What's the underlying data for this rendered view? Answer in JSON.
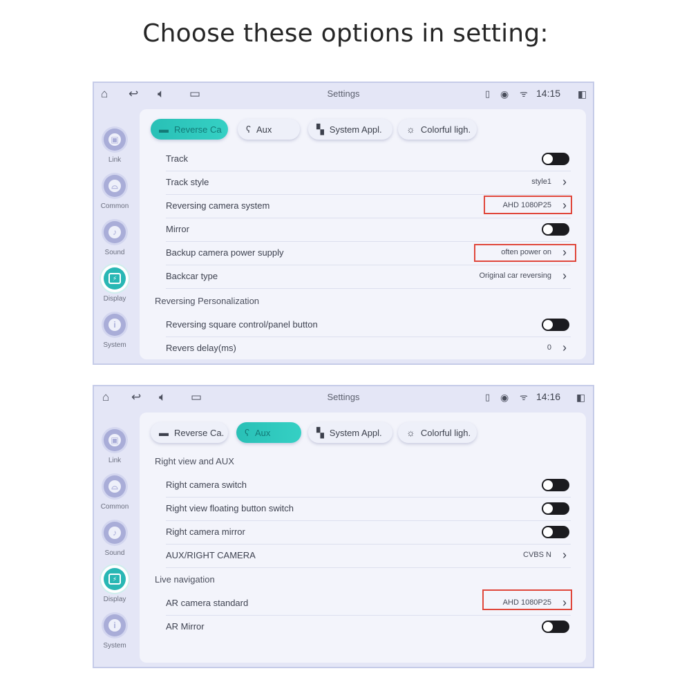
{
  "heading": "Choose these options in setting:",
  "screens": [
    {
      "title": "Settings",
      "time": "14:15",
      "sidebar": [
        {
          "label": "Link",
          "icon": "link-icon"
        },
        {
          "label": "Common",
          "icon": "car-icon"
        },
        {
          "label": "Sound",
          "icon": "speaker-icon"
        },
        {
          "label": "Display",
          "icon": "display-icon",
          "active": true
        },
        {
          "label": "System",
          "icon": "info-icon"
        }
      ],
      "tabs": [
        {
          "label": "Reverse Ca",
          "active": true
        },
        {
          "label": "Aux"
        },
        {
          "label": "System Appl."
        },
        {
          "label": "Colorful ligh."
        }
      ],
      "rows": [
        {
          "label": "Track",
          "type": "toggle",
          "state": "off"
        },
        {
          "label": "Track style",
          "type": "value",
          "value": "style1"
        },
        {
          "label": "Reversing camera system",
          "type": "value",
          "value": "AHD 1080P25",
          "highlighted": true
        },
        {
          "label": "Mirror",
          "type": "toggle",
          "state": "off"
        },
        {
          "label": "Backup camera power supply",
          "type": "value",
          "value": "often power on",
          "highlighted": true
        },
        {
          "label": "Backcar type",
          "type": "value",
          "value": "Original car reversing"
        }
      ],
      "section": "Reversing Personalization",
      "rows2": [
        {
          "label": "Reversing square control/panel button",
          "type": "toggle",
          "state": "off"
        },
        {
          "label": "Revers delay(ms)",
          "type": "value",
          "value": "0"
        }
      ]
    },
    {
      "title": "Settings",
      "time": "14:16",
      "sidebar": [
        {
          "label": "Link",
          "icon": "link-icon"
        },
        {
          "label": "Common",
          "icon": "car-icon"
        },
        {
          "label": "Sound",
          "icon": "speaker-icon"
        },
        {
          "label": "Display",
          "icon": "display-icon",
          "active": true
        },
        {
          "label": "System",
          "icon": "info-icon"
        }
      ],
      "tabs": [
        {
          "label": "Reverse Ca."
        },
        {
          "label": "Aux",
          "active": true
        },
        {
          "label": "System Appl."
        },
        {
          "label": "Colorful ligh."
        }
      ],
      "section": "Right view and AUX",
      "rows": [
        {
          "label": "Right camera switch",
          "type": "toggle",
          "state": "off"
        },
        {
          "label": "Right view floating button switch",
          "type": "toggle",
          "state": "off"
        },
        {
          "label": "Right camera mirror",
          "type": "toggle",
          "state": "off"
        },
        {
          "label": "AUX/RIGHT CAMERA",
          "type": "value",
          "value": "CVBS N"
        }
      ],
      "section2": "Live navigation",
      "rows2": [
        {
          "label": "AR camera standard",
          "type": "value",
          "value": "AHD 1080P25",
          "highlighted": true
        },
        {
          "label": "AR Mirror",
          "type": "toggle",
          "state": "off"
        }
      ]
    }
  ],
  "colors": {
    "accent": "#29c0b6",
    "highlight": "#e0463a",
    "screen_bg": "#e4e6f6",
    "panel_bg": "#f3f4fb"
  }
}
